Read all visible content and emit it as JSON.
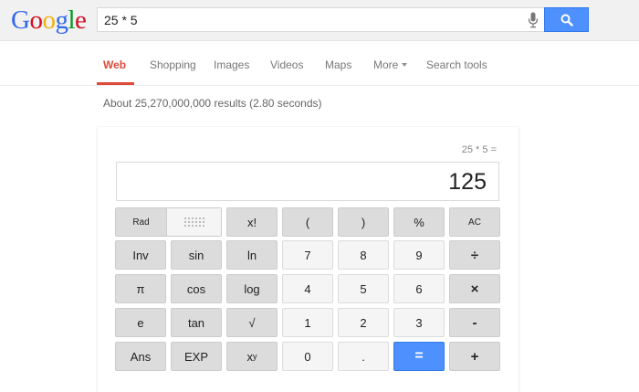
{
  "logo": {
    "letters": [
      "G",
      "o",
      "o",
      "g",
      "l",
      "e"
    ]
  },
  "search": {
    "query": "25 * 5"
  },
  "tabs": [
    {
      "label": "Web",
      "active": true
    },
    {
      "label": "Shopping"
    },
    {
      "label": "Images"
    },
    {
      "label": "Videos"
    },
    {
      "label": "Maps"
    },
    {
      "label": "More"
    },
    {
      "label": "Search tools"
    }
  ],
  "stats": "About 25,270,000,000 results (2.80 seconds)",
  "calculator": {
    "expression": "25 * 5 =",
    "result": "125",
    "rad_label": "Rad",
    "keys": {
      "fact": "x!",
      "lparen": "(",
      "rparen": ")",
      "percent": "%",
      "ac": "AC",
      "inv": "Inv",
      "sin": "sin",
      "ln": "ln",
      "seven": "7",
      "eight": "8",
      "nine": "9",
      "divide": "÷",
      "pi": "π",
      "cos": "cos",
      "log": "log",
      "four": "4",
      "five": "5",
      "six": "6",
      "multiply": "×",
      "e": "e",
      "tan": "tan",
      "sqrt": "√",
      "one": "1",
      "two": "2",
      "three": "3",
      "minus": "-",
      "ans": "Ans",
      "exp": "EXP",
      "zero": "0",
      "dot": ".",
      "equals": "=",
      "plus": "+"
    },
    "pow_base": "x",
    "pow_exp": "y"
  },
  "colors": {
    "accent_red": "#dd4b39",
    "accent_blue": "#4d90fe"
  }
}
